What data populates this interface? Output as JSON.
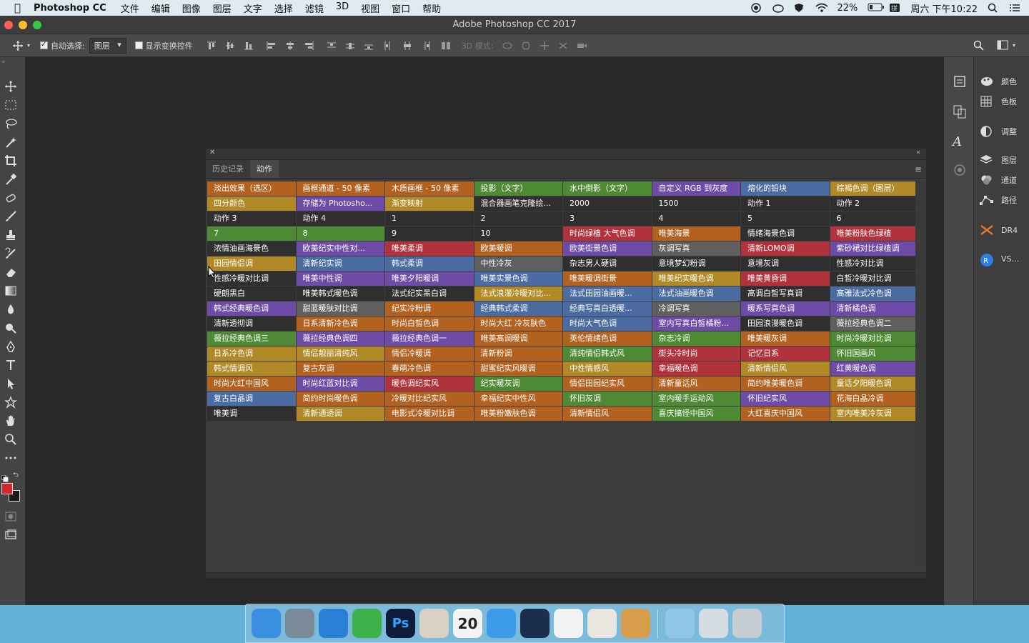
{
  "menubar": {
    "app": "Photoshop CC",
    "items": [
      "文件",
      "编辑",
      "图像",
      "图层",
      "文字",
      "选择",
      "滤镜",
      "3D",
      "视图",
      "窗口",
      "帮助"
    ],
    "battery": "22%",
    "clock": "周六 下午10:22"
  },
  "window": {
    "title": "Adobe Photoshop CC 2017"
  },
  "options": {
    "auto_select_label": "自动选择:",
    "auto_select_value": "图层",
    "show_transform_label": "显示变换控件",
    "mode_3d_label": "3D 模式:"
  },
  "right_panels": {
    "items": [
      {
        "label": "颜色",
        "icon": "palette-icon"
      },
      {
        "label": "色板",
        "icon": "grid-swatches-icon"
      },
      {
        "label": "调整",
        "icon": "adjustments-icon"
      },
      {
        "label": "图层",
        "icon": "layers-icon"
      },
      {
        "label": "通道",
        "icon": "channels-icon"
      },
      {
        "label": "路径",
        "icon": "paths-icon"
      },
      {
        "label": "DR4",
        "icon": "dr4-plugin-icon"
      },
      {
        "label": "VS...",
        "icon": "vs-plugin-icon"
      }
    ]
  },
  "actions_panel": {
    "tabs": [
      "历史记录",
      "动作"
    ],
    "active_tab": "动作",
    "rows": [
      [
        [
          "淡出效果（选区）",
          "o"
        ],
        [
          "画框通道 - 50 像素",
          "o"
        ],
        [
          "木质画框 - 50 像素",
          "o"
        ],
        [
          "投影（文字）",
          "g"
        ],
        [
          "水中倒影（文字）",
          "g"
        ],
        [
          "自定义 RGB 到灰度",
          "p"
        ],
        [
          "熔化的铅块",
          "b"
        ],
        [
          "棕褐色调（图层）",
          "y"
        ]
      ],
      [
        [
          "四分颜色",
          "y"
        ],
        [
          "存储为 Photosho...",
          "p"
        ],
        [
          "渐变映射",
          "y"
        ],
        [
          "混合器画笔克隆绘...",
          "k"
        ],
        [
          "2000",
          "k"
        ],
        [
          "1500",
          "k"
        ],
        [
          "动作 1",
          "k"
        ],
        [
          "动作 2",
          "k"
        ]
      ],
      [
        [
          "动作 3",
          "k"
        ],
        [
          "动作 4",
          "k"
        ],
        [
          "1",
          "k"
        ],
        [
          "2",
          "k"
        ],
        [
          "3",
          "k"
        ],
        [
          "4",
          "k"
        ],
        [
          "5",
          "k"
        ],
        [
          "6",
          "k"
        ]
      ],
      [
        [
          "7",
          "g"
        ],
        [
          "8",
          "g"
        ],
        [
          "9",
          "k"
        ],
        [
          "10",
          "k"
        ],
        [
          "时尚绿植 大气色调",
          "r"
        ],
        [
          "唯美海景",
          "o"
        ],
        [
          "情绪海景色调",
          "k"
        ],
        [
          "唯美粉肤色绿植",
          "r"
        ]
      ],
      [
        [
          "浓情油画海景色",
          "k"
        ],
        [
          "欧美纪实中性对...",
          "p"
        ],
        [
          "唯美柔调",
          "r"
        ],
        [
          "欧美暖调",
          "o"
        ],
        [
          "欧美街景色调",
          "p"
        ],
        [
          "灰调写真",
          "n"
        ],
        [
          "清新LOMO调",
          "r"
        ],
        [
          "紫砂裙对比绿植调",
          "p"
        ]
      ],
      [
        [
          "田园情侣调",
          "y"
        ],
        [
          "清新纪实调",
          "b"
        ],
        [
          "韩式柔调",
          "b"
        ],
        [
          "中性冷灰",
          "n"
        ],
        [
          "杂志男人硬调",
          "k"
        ],
        [
          "意境梦幻粉调",
          "k"
        ],
        [
          "意境灰调",
          "k"
        ],
        [
          "性感冷对比调",
          "k"
        ]
      ],
      [
        [
          "性感冷暖对比调",
          "k"
        ],
        [
          "唯美中性调",
          "p"
        ],
        [
          "唯美夕阳暖调",
          "p"
        ],
        [
          "唯美实景色调",
          "b"
        ],
        [
          "唯美暖调街景",
          "o"
        ],
        [
          "唯美纪实暖色调",
          "y"
        ],
        [
          "唯美黄昏调",
          "r"
        ],
        [
          "白皙冷暖对比调",
          "k"
        ]
      ],
      [
        [
          "硬朗黑白",
          "k"
        ],
        [
          "唯美韩式暖色调",
          "k"
        ],
        [
          "法式纪实黑白调",
          "k"
        ],
        [
          "法式浪漫冷暖对比...",
          "y"
        ],
        [
          "法式田园油画暖...",
          "b"
        ],
        [
          "法式油画暖色调",
          "b"
        ],
        [
          "高调白皙写真调",
          "k"
        ],
        [
          "高雅法式冷色调",
          "b"
        ]
      ],
      [
        [
          "韩式经典暖色调",
          "p"
        ],
        [
          "甜蓝暖肤对比调",
          "n"
        ],
        [
          "纪实冷粉调",
          "o"
        ],
        [
          "经典韩式柔调",
          "b"
        ],
        [
          "经典写真白透暖...",
          "b"
        ],
        [
          "冷调写真",
          "n"
        ],
        [
          "暖系写真色调",
          "p"
        ],
        [
          "清新橘色调",
          "p"
        ]
      ],
      [
        [
          "清新透彻调",
          "k"
        ],
        [
          "日系清新冷色调",
          "o"
        ],
        [
          "时尚白皙色调",
          "o"
        ],
        [
          "时尚大红 冷灰肤色",
          "o"
        ],
        [
          "时尚大气色调",
          "b"
        ],
        [
          "室内写真白皙橘粉...",
          "p"
        ],
        [
          "田园浪漫暖色调",
          "k"
        ],
        [
          "薇拉经典色调二",
          "n"
        ]
      ],
      [
        [
          "薇拉经典色调三",
          "g"
        ],
        [
          "薇拉经典色调四",
          "p"
        ],
        [
          "薇拉经典色调一",
          "p"
        ],
        [
          "唯美高调暖调",
          "o"
        ],
        [
          "英伦情绪色调",
          "o"
        ],
        [
          "杂志冷调",
          "g"
        ],
        [
          "唯美暖灰调",
          "o"
        ],
        [
          "时尚冷暖对比调",
          "g"
        ]
      ],
      [
        [
          "日系冷色调",
          "y"
        ],
        [
          "情侣靓丽清纯风",
          "y"
        ],
        [
          "情侣冷暖调",
          "o"
        ],
        [
          "清新粉调",
          "o"
        ],
        [
          "清纯情侣韩式风",
          "g"
        ],
        [
          "街头冷时尚",
          "r"
        ],
        [
          "记忆日系",
          "r"
        ],
        [
          "怀旧国画风",
          "g"
        ]
      ],
      [
        [
          "韩式情调风",
          "y"
        ],
        [
          "复古灰调",
          "o"
        ],
        [
          "春萌冷色调",
          "o"
        ],
        [
          "甜蜜纪实风暖调",
          "o"
        ],
        [
          "中性情感风",
          "y"
        ],
        [
          "幸福暖色调",
          "r"
        ],
        [
          "清新情侣风",
          "y"
        ],
        [
          "红黄暖色调",
          "p"
        ]
      ],
      [
        [
          "时尚大红中国风",
          "o"
        ],
        [
          "时尚红蓝对比调",
          "p"
        ],
        [
          "暖色调纪实风",
          "r"
        ],
        [
          "纪实暖灰调",
          "g"
        ],
        [
          "情侣田园纪实风",
          "o"
        ],
        [
          "清新童话风",
          "o"
        ],
        [
          "简约唯美暖色调",
          "o"
        ],
        [
          "童话夕阳暖色调",
          "y"
        ]
      ],
      [
        [
          "复古白晶调",
          "b"
        ],
        [
          "简约时尚暖色调",
          "o"
        ],
        [
          "冷暖对比纪实风",
          "o"
        ],
        [
          "幸福纪实中性风",
          "o"
        ],
        [
          "怀旧灰调",
          "g"
        ],
        [
          "室内暖手运动风",
          "g"
        ],
        [
          "怀旧纪实风",
          "p"
        ],
        [
          "花海白晶冷调",
          "o"
        ]
      ],
      [
        [
          "唯美调",
          "k"
        ],
        [
          "清新通透调",
          "y"
        ],
        [
          "电影式冷暖对比调",
          "o"
        ],
        [
          "唯美粉嫩肤色调",
          "o"
        ],
        [
          "清新情侣风",
          "o"
        ],
        [
          "喜庆搞怪中国风",
          "g"
        ],
        [
          "大红喜庆中国风",
          "o"
        ],
        [
          "室内唯美冷灰调",
          "y"
        ]
      ]
    ]
  },
  "dock": {
    "apps": [
      {
        "name": "finder",
        "color": "#3b8fe0",
        "label": ""
      },
      {
        "name": "launchpad",
        "color": "#7b8a99",
        "label": ""
      },
      {
        "name": "safari",
        "color": "#2c7fd6",
        "label": ""
      },
      {
        "name": "wechat",
        "color": "#3fb14a",
        "label": ""
      },
      {
        "name": "photoshop",
        "color": "#0d1d3a",
        "label": "Ps"
      },
      {
        "name": "notes-grid",
        "color": "#d9d2c2",
        "label": ""
      },
      {
        "name": "calendar",
        "color": "#f4f4f4",
        "label": "20"
      },
      {
        "name": "cloud-drive",
        "color": "#3c9be8",
        "label": ""
      },
      {
        "name": "quicktime",
        "color": "#1c2e4d",
        "label": ""
      },
      {
        "name": "baidu-netdisk",
        "color": "#f2f2f2",
        "label": ""
      },
      {
        "name": "textedit",
        "color": "#e8e6df",
        "label": ""
      },
      {
        "name": "archive",
        "color": "#d89d4a",
        "label": ""
      },
      {
        "name": "folder",
        "color": "#8fc6ea",
        "label": ""
      },
      {
        "name": "keyboard",
        "color": "#d5dde3",
        "label": ""
      },
      {
        "name": "trash",
        "color": "#c7ced3",
        "label": ""
      }
    ]
  },
  "colors": {
    "foreground": "#d7262b",
    "background": "#1a1a1a"
  }
}
